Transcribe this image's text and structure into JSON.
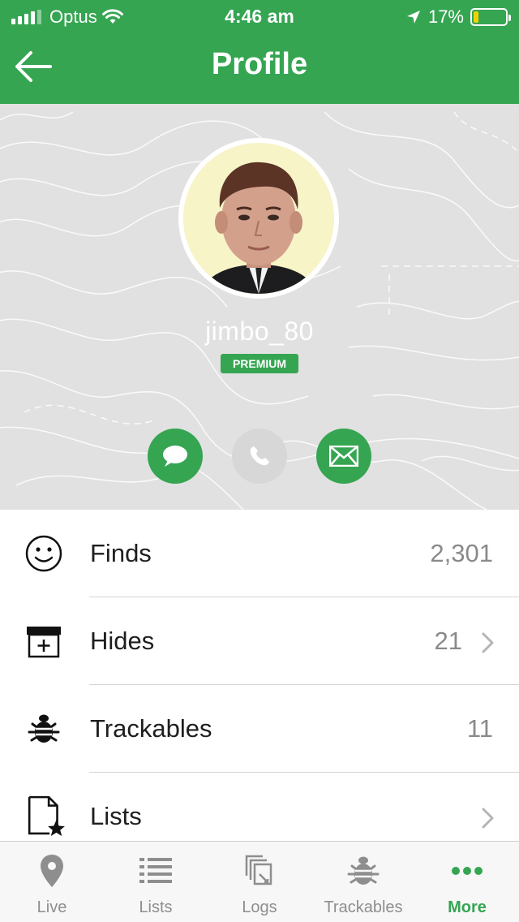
{
  "status_bar": {
    "carrier": "Optus",
    "time": "4:46 am",
    "battery": "17%",
    "battery_level": 0.17
  },
  "header": {
    "title": "Profile"
  },
  "profile": {
    "username": "jimbo_80",
    "badge": "PREMIUM"
  },
  "actions": [
    "message-icon",
    "phone-icon",
    "email-icon"
  ],
  "stats": {
    "finds": {
      "label": "Finds",
      "value": "2,301"
    },
    "hides": {
      "label": "Hides",
      "value": "21"
    },
    "trackables": {
      "label": "Trackables",
      "value": "11"
    },
    "lists": {
      "label": "Lists",
      "value": ""
    }
  },
  "tabs": [
    {
      "label": "Live",
      "icon": "map-pin-icon"
    },
    {
      "label": "Lists",
      "icon": "list-icon"
    },
    {
      "label": "Logs",
      "icon": "logs-icon"
    },
    {
      "label": "Trackables",
      "icon": "bug-icon"
    },
    {
      "label": "More",
      "icon": "more-dots-icon"
    }
  ],
  "colors": {
    "brand_green": "#35a552",
    "hero_background": "#e1e1e1",
    "disabled_action": "#d7d7d7"
  }
}
